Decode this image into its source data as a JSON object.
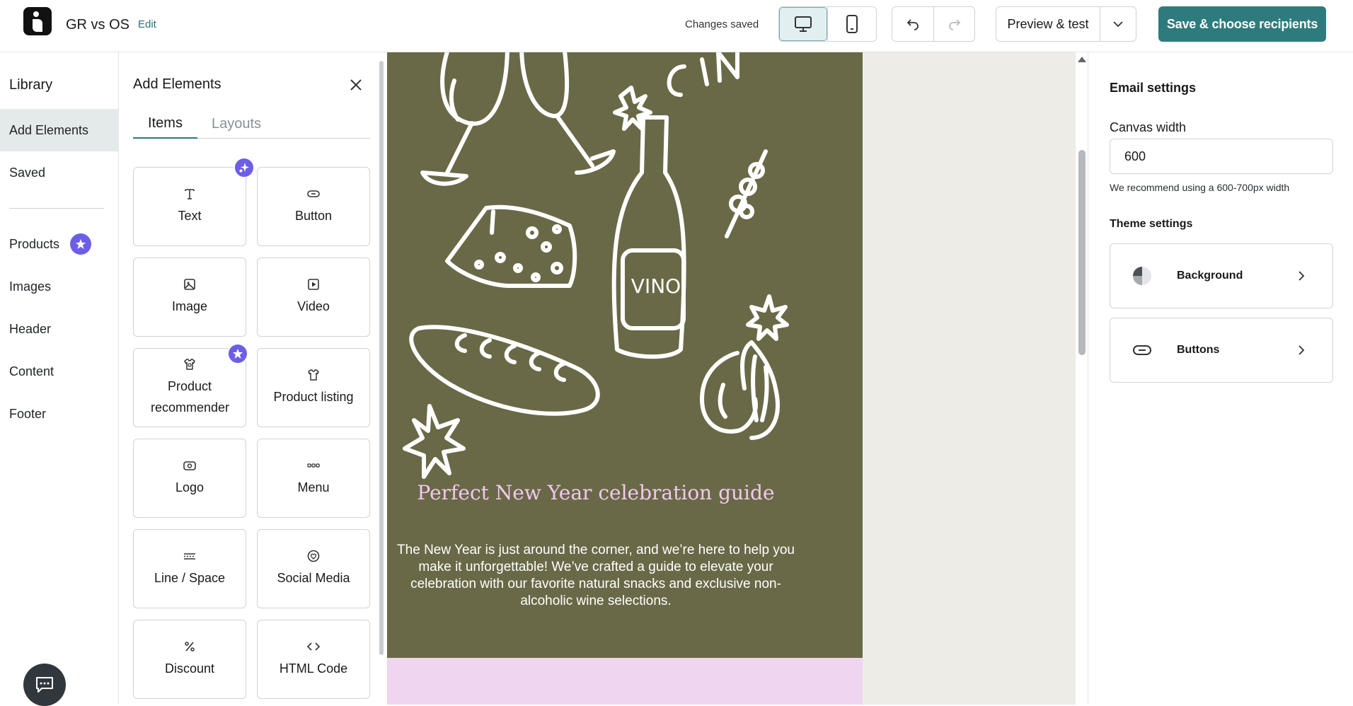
{
  "header": {
    "doc_title": "GR vs OS",
    "edit_label": "Edit",
    "status": "Changes saved",
    "preview_label": "Preview & test",
    "save_label": "Save & choose recipients",
    "active_device": "desktop"
  },
  "library": {
    "title": "Library",
    "items": [
      {
        "label": "Add Elements",
        "active": true
      },
      {
        "label": "Saved"
      },
      {
        "label": "Products",
        "badge": "star-icon"
      },
      {
        "label": "Images"
      },
      {
        "label": "Header"
      },
      {
        "label": "Content"
      },
      {
        "label": "Footer"
      }
    ]
  },
  "panel": {
    "title": "Add Elements",
    "tabs": [
      "Items",
      "Layouts"
    ],
    "active_tab": "Items",
    "tiles": [
      {
        "label": "Text",
        "icon": "text-icon",
        "badge": "ai-sparkle-icon"
      },
      {
        "label": "Button",
        "icon": "button-icon"
      },
      {
        "label": "Image",
        "icon": "image-icon"
      },
      {
        "label": "Video",
        "icon": "video-icon"
      },
      {
        "label": "Product recommender",
        "icon": "product-recommender-icon",
        "badge": "star-icon"
      },
      {
        "label": "Product listing",
        "icon": "product-listing-icon"
      },
      {
        "label": "Logo",
        "icon": "logo-icon"
      },
      {
        "label": "Menu",
        "icon": "menu-icon"
      },
      {
        "label": "Line / Space",
        "icon": "line-space-icon"
      },
      {
        "label": "Social Media",
        "icon": "social-media-icon"
      },
      {
        "label": "Discount",
        "icon": "discount-icon"
      },
      {
        "label": "HTML Code",
        "icon": "code-icon"
      }
    ]
  },
  "email": {
    "hero_background": "#696947",
    "headline": "Perfect New Year celebration guide",
    "headline_color": "#f1c8ef",
    "body": "The New Year is just around the corner, and we’re here to help you make it unforgettable! We’ve crafted a guide to elevate your celebration with our favorite natural snacks and exclusive non-alcoholic wine selections.",
    "bottle_label": "VINO",
    "partial_word": "CIN",
    "footer_band_color": "#efd5ef"
  },
  "settings": {
    "title": "Email settings",
    "canvas_width_label": "Canvas width",
    "canvas_width_value": "600",
    "hint": "We recommend using a 600-700px width",
    "theme_label": "Theme settings",
    "theme_rows": [
      {
        "label": "Background",
        "icon": "background-icon"
      },
      {
        "label": "Buttons",
        "icon": "buttons-icon"
      }
    ]
  },
  "colors": {
    "accent": "#2e7b7d",
    "badge": "#6d5ee8",
    "canvas_bg": "#eeece7"
  }
}
